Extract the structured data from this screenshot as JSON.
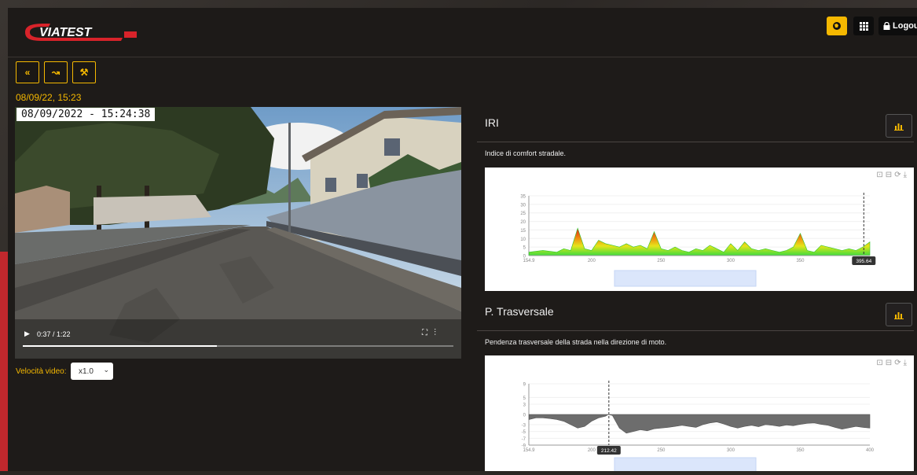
{
  "header": {
    "brand_name": "VIATEST",
    "lang_icon": "globe-icon",
    "apps_icon": "grid-icon",
    "logout_icon": "lock-icon",
    "logout_label": "Logout",
    "accent_color": "#f5b800"
  },
  "toolbar": {
    "buttons": [
      {
        "icon": "double-chevron-left-icon",
        "glyph": "«"
      },
      {
        "icon": "route-icon",
        "glyph": "↝"
      },
      {
        "icon": "hammer-icon",
        "glyph": "⚒"
      }
    ]
  },
  "session": {
    "datetime": "08/09/22, 15:23"
  },
  "video": {
    "timestamp_overlay": "08/09/2022 - 15:24:38",
    "time": "0:37 / 1:22",
    "progress": 0.45,
    "speed_label": "Velocità video:",
    "speed_value": "x1.0"
  },
  "panels": [
    {
      "title": "IRI",
      "description": "Indice di comfort stradale.",
      "button_icon": "chart-icon",
      "chart_data": {
        "type": "area",
        "x_ticks": [
          "154.9",
          "200",
          "250",
          "300",
          "350"
        ],
        "y_ticks": [
          "0",
          "5",
          "10",
          "15",
          "20",
          "25",
          "30",
          "35"
        ],
        "ylim": [
          0,
          35
        ],
        "xlim": [
          154.9,
          400
        ],
        "x": [
          155,
          165,
          175,
          180,
          185,
          190,
          195,
          200,
          205,
          210,
          215,
          220,
          225,
          230,
          235,
          240,
          245,
          250,
          255,
          260,
          265,
          270,
          275,
          280,
          285,
          290,
          295,
          300,
          305,
          310,
          315,
          320,
          325,
          330,
          335,
          340,
          345,
          350,
          355,
          360,
          365,
          370,
          375,
          380,
          385,
          390,
          395,
          400
        ],
        "values": [
          2,
          3,
          2,
          4,
          3,
          16,
          4,
          3,
          9,
          7,
          6,
          5,
          7,
          5,
          6,
          4,
          14,
          4,
          3,
          5,
          3,
          2,
          4,
          3,
          6,
          4,
          2,
          7,
          3,
          8,
          4,
          3,
          4,
          3,
          2,
          3,
          5,
          13,
          3,
          2,
          6,
          5,
          4,
          3,
          4,
          3,
          5,
          8
        ],
        "cursor_label": "395.64",
        "cursor_x": 395.64,
        "grid": true
      }
    },
    {
      "title": "P. Trasversale",
      "description": "Pendenza trasversale della strada nella direzione di moto.",
      "button_icon": "chart-icon",
      "chart_data": {
        "type": "area",
        "x_ticks": [
          "154.9",
          "200",
          "250",
          "300",
          "350",
          "400"
        ],
        "y_ticks": [
          "-9",
          "-7",
          "-5",
          "-3",
          "0",
          "3",
          "5",
          "9"
        ],
        "ylim": [
          -9,
          9
        ],
        "xlim": [
          154.9,
          400
        ],
        "x": [
          155,
          160,
          165,
          170,
          175,
          180,
          185,
          190,
          195,
          200,
          205,
          210,
          212,
          215,
          220,
          225,
          230,
          235,
          240,
          245,
          250,
          255,
          260,
          265,
          270,
          275,
          280,
          285,
          290,
          295,
          300,
          305,
          310,
          315,
          320,
          325,
          330,
          335,
          340,
          345,
          350,
          355,
          360,
          365,
          370,
          375,
          380,
          385,
          390,
          395,
          400
        ],
        "values": [
          -1.5,
          -1,
          -1,
          -1.2,
          -1.5,
          -2,
          -3,
          -4,
          -3.5,
          -2,
          -1,
          -0.5,
          0,
          -0.3,
          -4,
          -5.5,
          -5,
          -4.5,
          -4.8,
          -4.2,
          -4,
          -3.8,
          -3.5,
          -3.2,
          -3.5,
          -3.8,
          -3,
          -2.5,
          -2.2,
          -2.8,
          -3.5,
          -4,
          -3.5,
          -3.2,
          -3.6,
          -3,
          -3.2,
          -3.5,
          -3.1,
          -3.3,
          -2.9,
          -2.6,
          -2.5,
          -2.9,
          -3.2,
          -3.8,
          -4.3,
          -3.9,
          -3.5,
          -3.8,
          -4
        ],
        "cursor_label": "212.42",
        "cursor_x": 212.42,
        "grid": true
      }
    }
  ]
}
